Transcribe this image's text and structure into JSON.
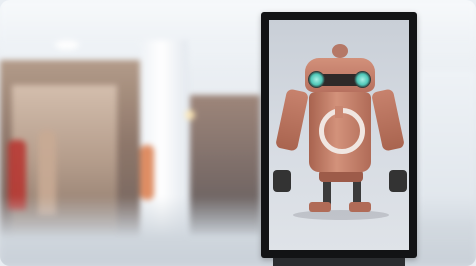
{
  "scene": {
    "description_type": "photo",
    "subject": "digital-signage-display",
    "background": "blurred-shopping-mall",
    "screen_content": "robot-character"
  },
  "colors": {
    "sign_frame": "#121315",
    "robot_body": "#c98670",
    "robot_eyes": "#4fc7b7",
    "background_floor": "#cfd6dd"
  }
}
